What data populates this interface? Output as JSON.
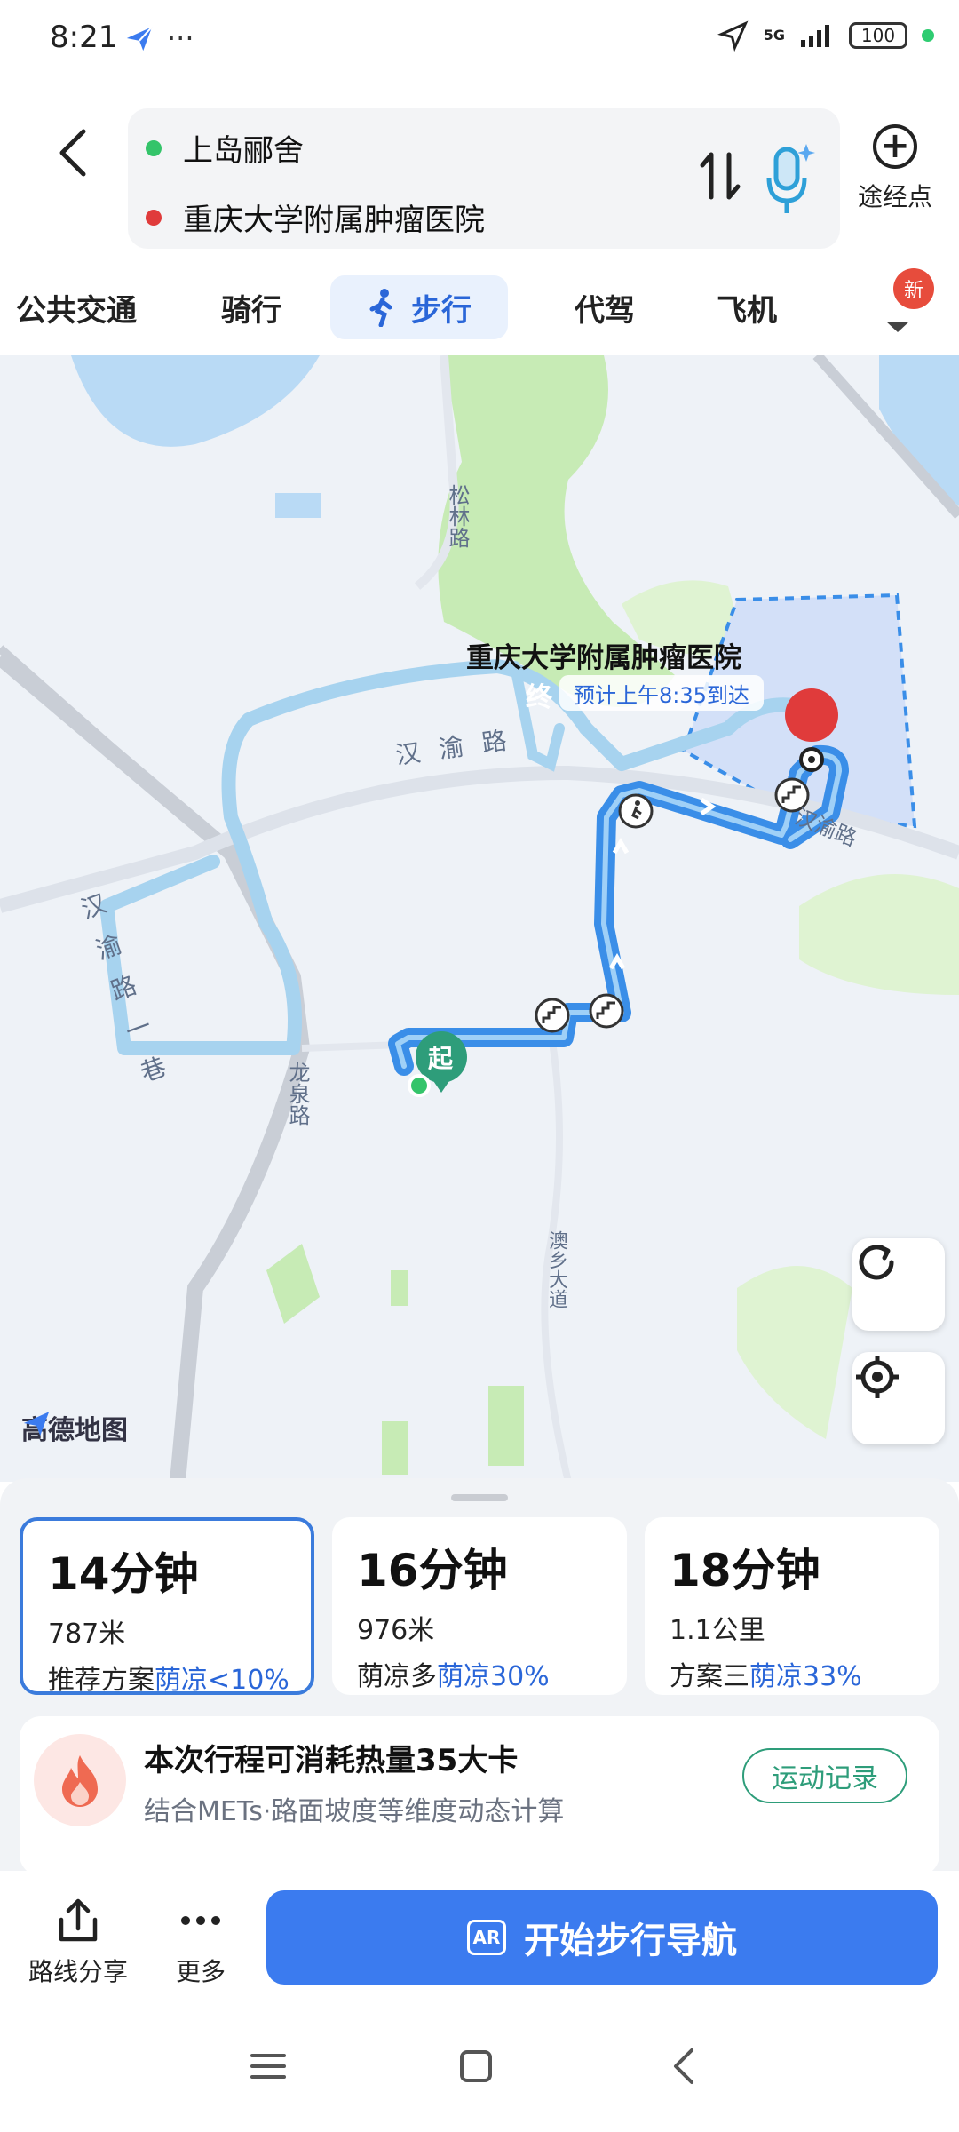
{
  "status_bar": {
    "time": "8:21",
    "dots": "···",
    "network": "5G",
    "battery": "100"
  },
  "header": {
    "start_point": "上岛郦舍",
    "end_point": "重庆大学附属肿瘤医院",
    "via_label": "途经点",
    "colors": {
      "start_dot": "#34c46a",
      "end_dot": "#e03b3b"
    }
  },
  "mode_tabs": {
    "items": [
      {
        "label": "公共交通"
      },
      {
        "label": "骑行"
      },
      {
        "label": "步行"
      },
      {
        "label": "代驾"
      },
      {
        "label": "飞机"
      }
    ],
    "active": "步行",
    "new_badge": "新"
  },
  "map": {
    "destination_name": "重庆大学附属肿瘤医院",
    "eta": "预计上午8:35到达",
    "start_marker": "起",
    "end_marker": "终",
    "road_labels": {
      "songlin": "松林路",
      "hanyu_top": "汉 渝 路",
      "hanyu_right": "汉渝路",
      "hanyu_lane": "汉 渝 路 一 巷",
      "longquan": "龙泉路",
      "aoxiang": "澳乡大道"
    },
    "logo": "高德地图",
    "colors": {
      "route": "#3a8ee8",
      "alt_route": "#a7d3ef",
      "water": "#b9daf5",
      "green": "#c7ebb5"
    }
  },
  "plans": [
    {
      "time": "14分钟",
      "distance": "787米",
      "tag": "推荐方案",
      "shade": "荫凉<10%",
      "selected": true
    },
    {
      "time": "16分钟",
      "distance": "976米",
      "tag": "荫凉多",
      "shade": "荫凉30%",
      "selected": false
    },
    {
      "time": "18分钟",
      "distance": "1.1公里",
      "tag": "方案三",
      "shade": "荫凉33%",
      "selected": false
    }
  ],
  "calorie": {
    "title": "本次行程可消耗热量35大卡",
    "subtitle": "结合METs·路面坡度等维度动态计算",
    "button": "运动记录"
  },
  "actions": {
    "share": "路线分享",
    "more": "更多",
    "start_nav": "开始步行导航",
    "ar": "AR"
  }
}
